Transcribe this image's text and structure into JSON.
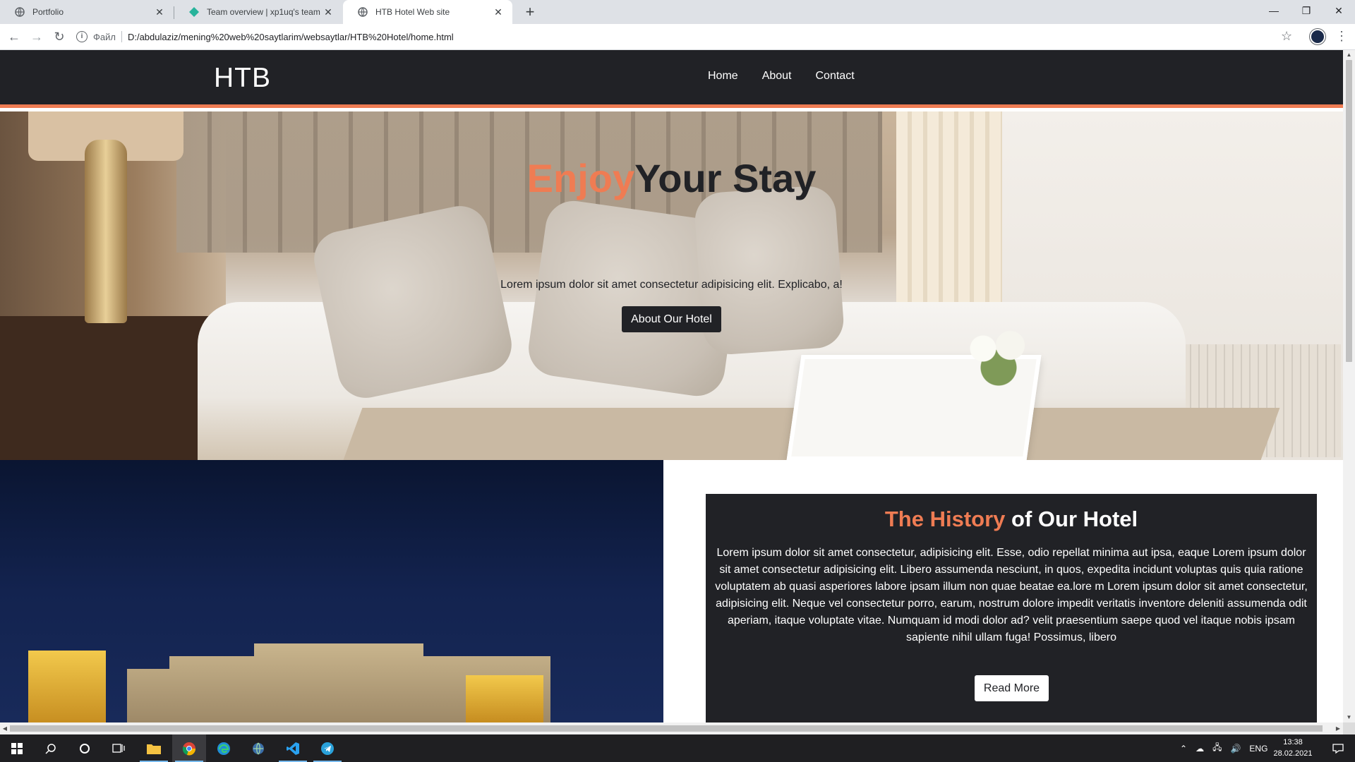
{
  "browser": {
    "tabs": [
      {
        "title": "Portfolio",
        "active": false
      },
      {
        "title": "Team overview | xp1uq's team",
        "active": false
      },
      {
        "title": "HTB Hotel Web site",
        "active": true
      }
    ],
    "address": {
      "scheme_label": "Файл",
      "url": "D:/abdulaziz/mening%20web%20saytlarim/websaytlar/HTB%20Hotel/home.html"
    }
  },
  "site": {
    "logo": "HTB",
    "nav": [
      "Home",
      "About",
      "Contact"
    ],
    "hero": {
      "title_accent": "Enjoy",
      "title_rest": "Your Stay",
      "subtitle": "Lorem ipsum dolor sit amet consectetur adipisicing elit. Explicabo, a!",
      "button": "About Our Hotel"
    },
    "history": {
      "title_accent": "The History",
      "title_rest": " of Our Hotel",
      "body": "Lorem ipsum dolor sit amet consectetur, adipisicing elit. Esse, odio repellat minima aut ipsa, eaque Lorem ipsum dolor sit amet consectetur adipisicing elit. Libero assumenda nesciunt, in quos, expedita incidunt voluptas quis quia ratione voluptatem ab quasi asperiores labore ipsam illum non quae beatae ea.lore m Lorem ipsum dolor sit amet consectetur, adipisicing elit. Neque vel consectetur porro, earum, nostrum dolore impedit veritatis inventore deleniti assumenda odit aperiam, itaque voluptate vitae. Numquam id modi dolor ad? velit praesentium saepe quod vel itaque nobis ipsam sapiente nihil ullam fuga! Possimus, libero",
      "button": "Read More"
    },
    "colors": {
      "accent": "#ef7c53",
      "dark": "#212226"
    }
  },
  "taskbar": {
    "language": "ENG",
    "time": "13:38",
    "date": "28.02.2021"
  }
}
